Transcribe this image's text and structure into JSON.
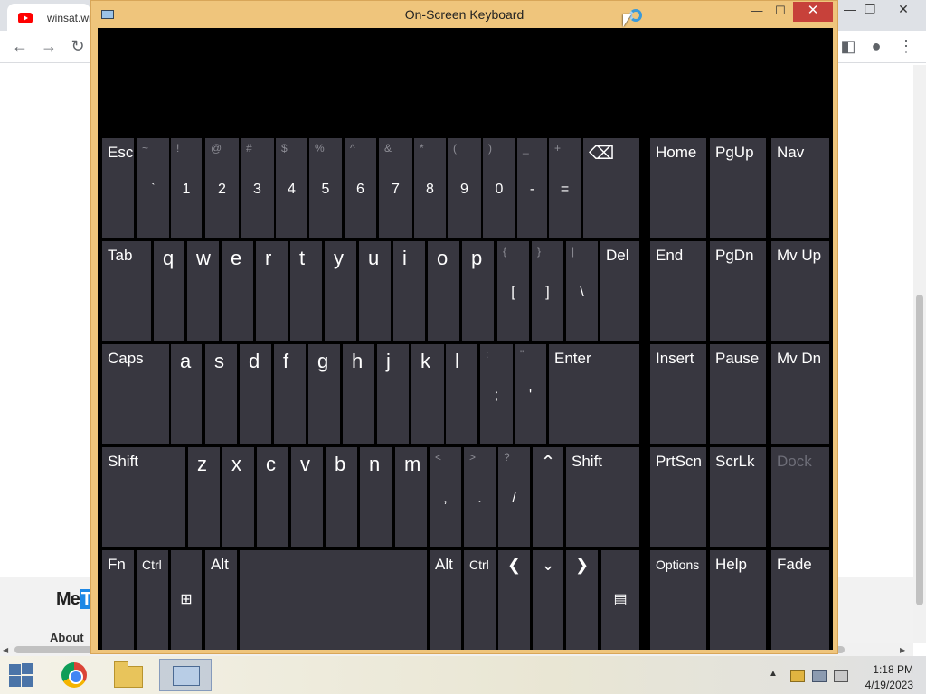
{
  "browser": {
    "tab_title": "winsat.wm",
    "window_controls": {
      "minimize": "—",
      "restore": "❐",
      "close": "✕"
    },
    "footer_link": "About",
    "logo_text_a": "Me",
    "logo_text_b": "T"
  },
  "osk": {
    "title": "On-Screen Keyboard",
    "controls": {
      "minimize": "—",
      "maximize": "☐",
      "close": "✕"
    },
    "row1": [
      {
        "label": "Esc"
      },
      {
        "top": "~",
        "main": "`"
      },
      {
        "top": "!",
        "main": "1"
      },
      {
        "top": "@",
        "main": "2"
      },
      {
        "top": "#",
        "main": "3"
      },
      {
        "top": "$",
        "main": "4"
      },
      {
        "top": "%",
        "main": "5"
      },
      {
        "top": "^",
        "main": "6"
      },
      {
        "top": "&",
        "main": "7"
      },
      {
        "top": "*",
        "main": "8"
      },
      {
        "top": "(",
        "main": "9"
      },
      {
        "top": ")",
        "main": "0"
      },
      {
        "top": "_",
        "main": "-"
      },
      {
        "top": "+",
        "main": "="
      },
      {
        "icon": "backspace-icon"
      },
      {
        "label": "Home"
      },
      {
        "label": "PgUp"
      },
      {
        "label": "Nav"
      }
    ],
    "row2": [
      {
        "label": "Tab"
      },
      {
        "letter": "q"
      },
      {
        "letter": "w"
      },
      {
        "letter": "e"
      },
      {
        "letter": "r"
      },
      {
        "letter": "t"
      },
      {
        "letter": "y"
      },
      {
        "letter": "u"
      },
      {
        "letter": "i"
      },
      {
        "letter": "o"
      },
      {
        "letter": "p"
      },
      {
        "top": "{",
        "main": "["
      },
      {
        "top": "}",
        "main": "]"
      },
      {
        "top": "|",
        "main": "\\"
      },
      {
        "label": "Del"
      },
      {
        "label": "End"
      },
      {
        "label": "PgDn"
      },
      {
        "label": "Mv Up"
      }
    ],
    "row3": [
      {
        "label": "Caps"
      },
      {
        "letter": "a"
      },
      {
        "letter": "s"
      },
      {
        "letter": "d"
      },
      {
        "letter": "f"
      },
      {
        "letter": "g"
      },
      {
        "letter": "h"
      },
      {
        "letter": "j"
      },
      {
        "letter": "k"
      },
      {
        "letter": "l"
      },
      {
        "top": ":",
        "main": ";"
      },
      {
        "top": "\"",
        "main": "'"
      },
      {
        "label": "Enter"
      },
      {
        "label": "Insert"
      },
      {
        "label": "Pause"
      },
      {
        "label": "Mv Dn"
      }
    ],
    "row4": [
      {
        "label": "Shift"
      },
      {
        "letter": "z"
      },
      {
        "letter": "x"
      },
      {
        "letter": "c"
      },
      {
        "letter": "v"
      },
      {
        "letter": "b"
      },
      {
        "letter": "n"
      },
      {
        "letter": "m"
      },
      {
        "top": "<",
        "main": ","
      },
      {
        "top": ">",
        "main": "."
      },
      {
        "top": "?",
        "main": "/"
      },
      {
        "icon": "up-arrow-icon"
      },
      {
        "label": "Shift"
      },
      {
        "label": "PrtScn"
      },
      {
        "label": "ScrLk"
      },
      {
        "label": "Dock"
      }
    ],
    "row5": [
      {
        "label": "Fn"
      },
      {
        "label": "Ctrl"
      },
      {
        "icon": "windows-icon"
      },
      {
        "label": "Alt"
      },
      {
        "label": ""
      },
      {
        "label": "Alt"
      },
      {
        "label": "Ctrl"
      },
      {
        "icon": "left-arrow-icon"
      },
      {
        "icon": "down-arrow-icon"
      },
      {
        "icon": "right-arrow-icon"
      },
      {
        "icon": "context-menu-icon"
      },
      {
        "label": "Options"
      },
      {
        "label": "Help"
      },
      {
        "label": "Fade"
      }
    ]
  },
  "taskbar": {
    "time": "1:18 PM",
    "date": "4/19/2023",
    "tray_arrow": "▲"
  },
  "colors": {
    "key_bg": "#383740",
    "osk_frame": "#efc57c",
    "close_red": "#c7413a"
  }
}
